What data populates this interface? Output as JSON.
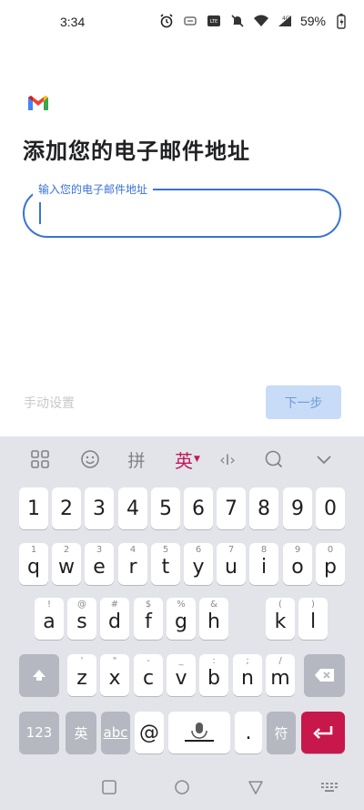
{
  "status_bar": {
    "time": "3:34",
    "battery_percent": "59%",
    "icons": [
      "alarm-icon",
      "screenshot-icon",
      "volte-icon",
      "mute-icon",
      "wifi-icon",
      "4g-signal-icon",
      "battery-icon"
    ]
  },
  "header": {
    "logo": "gmail-logo",
    "title": "添加您的电子邮件地址"
  },
  "email_field": {
    "label": "输入您的电子邮件地址",
    "value": ""
  },
  "actions": {
    "manual_setup": "手动设置",
    "next": "下一步"
  },
  "keyboard": {
    "toolbar": {
      "pinyin": "拼",
      "language": "英",
      "cursor_label": "‹I›"
    },
    "row_numbers": [
      "1",
      "2",
      "3",
      "4",
      "5",
      "6",
      "7",
      "8",
      "9",
      "0"
    ],
    "row1": [
      {
        "hint": "1",
        "key": "q"
      },
      {
        "hint": "2",
        "key": "w"
      },
      {
        "hint": "3",
        "key": "e"
      },
      {
        "hint": "4",
        "key": "r"
      },
      {
        "hint": "5",
        "key": "t"
      },
      {
        "hint": "6",
        "key": "y"
      },
      {
        "hint": "7",
        "key": "u"
      },
      {
        "hint": "8",
        "key": "i"
      },
      {
        "hint": "9",
        "key": "o"
      },
      {
        "hint": "0",
        "key": "p"
      }
    ],
    "row2": [
      {
        "hint": "!",
        "key": "a"
      },
      {
        "hint": "@",
        "key": "s"
      },
      {
        "hint": "#",
        "key": "d"
      },
      {
        "hint": "$",
        "key": "f"
      },
      {
        "hint": "%",
        "key": "g"
      },
      {
        "hint": "&",
        "key": "h"
      },
      {
        "hint": "(",
        "key": "k"
      },
      {
        "hint": ")",
        "key": "l"
      }
    ],
    "row3": [
      {
        "hint": "'",
        "key": "z"
      },
      {
        "hint": "\"",
        "key": "x"
      },
      {
        "hint": "-",
        "key": "c"
      },
      {
        "hint": "_",
        "key": "v"
      },
      {
        "hint": ":",
        "key": "b"
      },
      {
        "hint": ";",
        "key": "n"
      },
      {
        "hint": "/",
        "key": "m"
      }
    ],
    "bottom": {
      "num_key": "123",
      "lang_key": "英",
      "abc_key": "abc",
      "at_key": "@",
      "period_key": ".",
      "symbol_key": "符"
    }
  },
  "colors": {
    "accent_blue": "#3a72d8",
    "next_button_bg": "#c9dcf7",
    "keyboard_bg": "#e3e4e9",
    "enter_key": "#c8174a"
  }
}
